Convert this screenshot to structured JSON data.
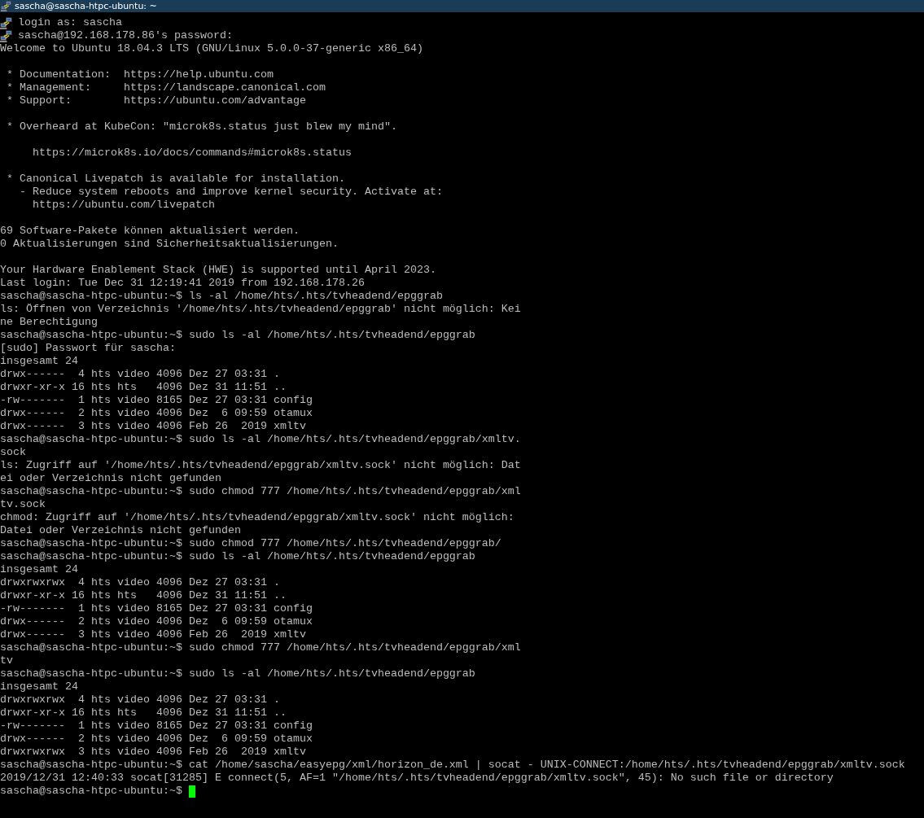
{
  "window": {
    "title": "sascha@sascha-htpc-ubuntu: ~"
  },
  "lines": [
    {
      "kind": "notice",
      "text": "login as: sascha"
    },
    {
      "kind": "notice",
      "text": "sascha@192.168.178.86's password:"
    },
    {
      "kind": "output",
      "text": "Welcome to Ubuntu 18.04.3 LTS (GNU/Linux 5.0.0-37-generic x86_64)"
    },
    {
      "kind": "blank"
    },
    {
      "kind": "output",
      "text": " * Documentation:  https://help.ubuntu.com"
    },
    {
      "kind": "output",
      "text": " * Management:     https://landscape.canonical.com"
    },
    {
      "kind": "output",
      "text": " * Support:        https://ubuntu.com/advantage"
    },
    {
      "kind": "blank"
    },
    {
      "kind": "output",
      "text": " * Overheard at KubeCon: \"microk8s.status just blew my mind\"."
    },
    {
      "kind": "blank"
    },
    {
      "kind": "output",
      "text": "     https://microk8s.io/docs/commands#microk8s.status"
    },
    {
      "kind": "blank"
    },
    {
      "kind": "output",
      "text": " * Canonical Livepatch is available for installation."
    },
    {
      "kind": "output",
      "text": "   - Reduce system reboots and improve kernel security. Activate at:"
    },
    {
      "kind": "output",
      "text": "     https://ubuntu.com/livepatch"
    },
    {
      "kind": "blank"
    },
    {
      "kind": "output",
      "text": "69 Software-Pakete können aktualisiert werden."
    },
    {
      "kind": "output",
      "text": "0 Aktualisierungen sind Sicherheitsaktualisierungen."
    },
    {
      "kind": "blank"
    },
    {
      "kind": "output",
      "text": "Your Hardware Enablement Stack (HWE) is supported until April 2023."
    },
    {
      "kind": "output",
      "text": "Last login: Tue Dec 31 12:19:41 2019 from 192.168.178.26"
    },
    {
      "kind": "output",
      "text": "sascha@sascha-htpc-ubuntu:~$ ls -al /home/hts/.hts/tvheadend/epggrab"
    },
    {
      "kind": "output",
      "text": "ls: Öffnen von Verzeichnis '/home/hts/.hts/tvheadend/epggrab' nicht möglich: Kei"
    },
    {
      "kind": "output",
      "text": "ne Berechtigung"
    },
    {
      "kind": "output",
      "text": "sascha@sascha-htpc-ubuntu:~$ sudo ls -al /home/hts/.hts/tvheadend/epggrab"
    },
    {
      "kind": "output",
      "text": "[sudo] Passwort für sascha:"
    },
    {
      "kind": "output",
      "text": "insgesamt 24"
    },
    {
      "kind": "output",
      "text": "drwx------  4 hts video 4096 Dez 27 03:31 ."
    },
    {
      "kind": "output",
      "text": "drwxr-xr-x 16 hts hts   4096 Dez 31 11:51 .."
    },
    {
      "kind": "output",
      "text": "-rw-------  1 hts video 8165 Dez 27 03:31 config"
    },
    {
      "kind": "output",
      "text": "drwx------  2 hts video 4096 Dez  6 09:59 otamux"
    },
    {
      "kind": "output",
      "text": "drwx------  3 hts video 4096 Feb 26  2019 xmltv"
    },
    {
      "kind": "output",
      "text": "sascha@sascha-htpc-ubuntu:~$ sudo ls -al /home/hts/.hts/tvheadend/epggrab/xmltv."
    },
    {
      "kind": "output",
      "text": "sock"
    },
    {
      "kind": "output",
      "text": "ls: Zugriff auf '/home/hts/.hts/tvheadend/epggrab/xmltv.sock' nicht möglich: Dat"
    },
    {
      "kind": "output",
      "text": "ei oder Verzeichnis nicht gefunden"
    },
    {
      "kind": "output",
      "text": "sascha@sascha-htpc-ubuntu:~$ sudo chmod 777 /home/hts/.hts/tvheadend/epggrab/xml"
    },
    {
      "kind": "output",
      "text": "tv.sock"
    },
    {
      "kind": "output",
      "text": "chmod: Zugriff auf '/home/hts/.hts/tvheadend/epggrab/xmltv.sock' nicht möglich:"
    },
    {
      "kind": "output",
      "text": "Datei oder Verzeichnis nicht gefunden"
    },
    {
      "kind": "output",
      "text": "sascha@sascha-htpc-ubuntu:~$ sudo chmod 777 /home/hts/.hts/tvheadend/epggrab/"
    },
    {
      "kind": "output",
      "text": "sascha@sascha-htpc-ubuntu:~$ sudo ls -al /home/hts/.hts/tvheadend/epggrab"
    },
    {
      "kind": "output",
      "text": "insgesamt 24"
    },
    {
      "kind": "output",
      "text": "drwxrwxrwx  4 hts video 4096 Dez 27 03:31 ."
    },
    {
      "kind": "output",
      "text": "drwxr-xr-x 16 hts hts   4096 Dez 31 11:51 .."
    },
    {
      "kind": "output",
      "text": "-rw-------  1 hts video 8165 Dez 27 03:31 config"
    },
    {
      "kind": "output",
      "text": "drwx------  2 hts video 4096 Dez  6 09:59 otamux"
    },
    {
      "kind": "output",
      "text": "drwx------  3 hts video 4096 Feb 26  2019 xmltv"
    },
    {
      "kind": "output",
      "text": "sascha@sascha-htpc-ubuntu:~$ sudo chmod 777 /home/hts/.hts/tvheadend/epggrab/xml"
    },
    {
      "kind": "output",
      "text": "tv"
    },
    {
      "kind": "output",
      "text": "sascha@sascha-htpc-ubuntu:~$ sudo ls -al /home/hts/.hts/tvheadend/epggrab"
    },
    {
      "kind": "output",
      "text": "insgesamt 24"
    },
    {
      "kind": "output",
      "text": "drwxrwxrwx  4 hts video 4096 Dez 27 03:31 ."
    },
    {
      "kind": "output",
      "text": "drwxr-xr-x 16 hts hts   4096 Dez 31 11:51 .."
    },
    {
      "kind": "output",
      "text": "-rw-------  1 hts video 8165 Dez 27 03:31 config"
    },
    {
      "kind": "output",
      "text": "drwx------  2 hts video 4096 Dez  6 09:59 otamux"
    },
    {
      "kind": "output",
      "text": "drwxrwxrwx  3 hts video 4096 Feb 26  2019 xmltv"
    },
    {
      "kind": "output",
      "text": "sascha@sascha-htpc-ubuntu:~$ cat /home/sascha/easyepg/xml/horizon_de.xml | socat - UNIX-CONNECT:/home/hts/.hts/tvheadend/epggrab/xmltv.sock"
    },
    {
      "kind": "output",
      "text": "2019/12/31 12:40:33 socat[31285] E connect(5, AF=1 \"/home/hts/.hts/tvheadend/epggrab/xmltv.sock\", 45): No such file or directory"
    },
    {
      "kind": "output",
      "text": "sascha@sascha-htpc-ubuntu:~$ "
    }
  ],
  "cursor_visible": true
}
